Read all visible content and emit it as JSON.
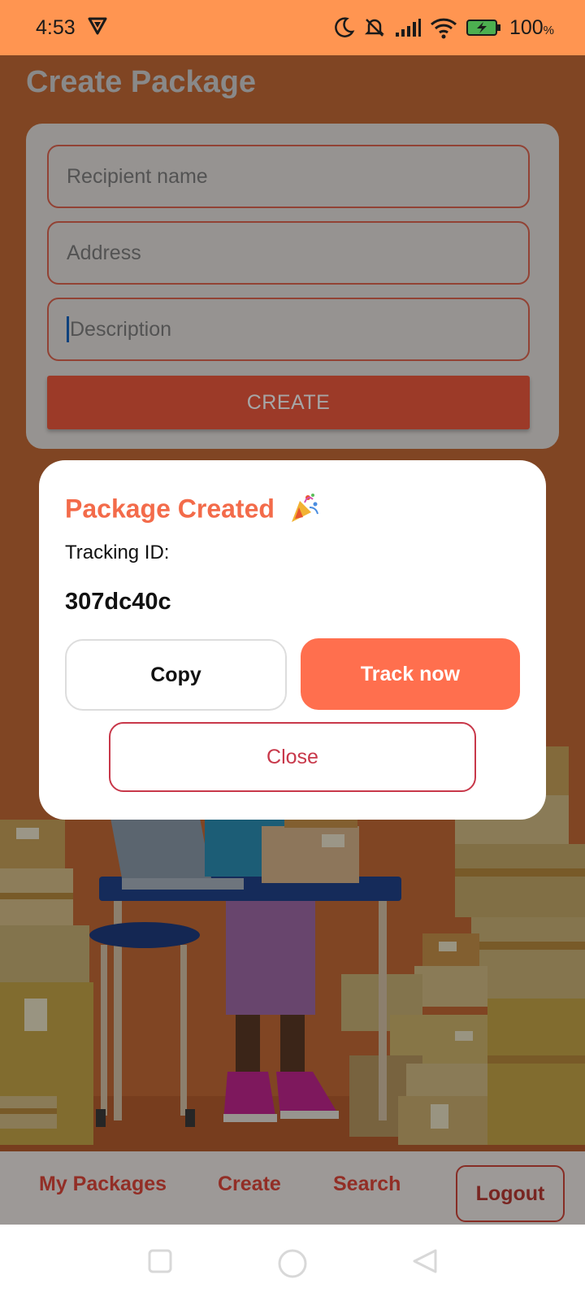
{
  "status_bar": {
    "time": "4:53",
    "battery_percent": "100",
    "battery_unit": "%"
  },
  "page": {
    "title": "Create Package"
  },
  "form": {
    "recipient_placeholder": "Recipient name",
    "address_placeholder": "Address",
    "description_placeholder": "Description",
    "create_label": "CREATE"
  },
  "dialog": {
    "title": "Package Created",
    "title_icon": "party-popper-icon",
    "tracking_label": "Tracking ID:",
    "tracking_id": "307dc40c",
    "copy_label": "Copy",
    "track_label": "Track now",
    "close_label": "Close"
  },
  "bottom_nav": {
    "items": [
      "My Packages",
      "Create",
      "Search"
    ],
    "logout_label": "Logout"
  },
  "colors": {
    "status_bar": "#ff9551",
    "accent": "#ff6f4e",
    "title_accent": "#f36b4a",
    "close_red": "#c8384a"
  }
}
